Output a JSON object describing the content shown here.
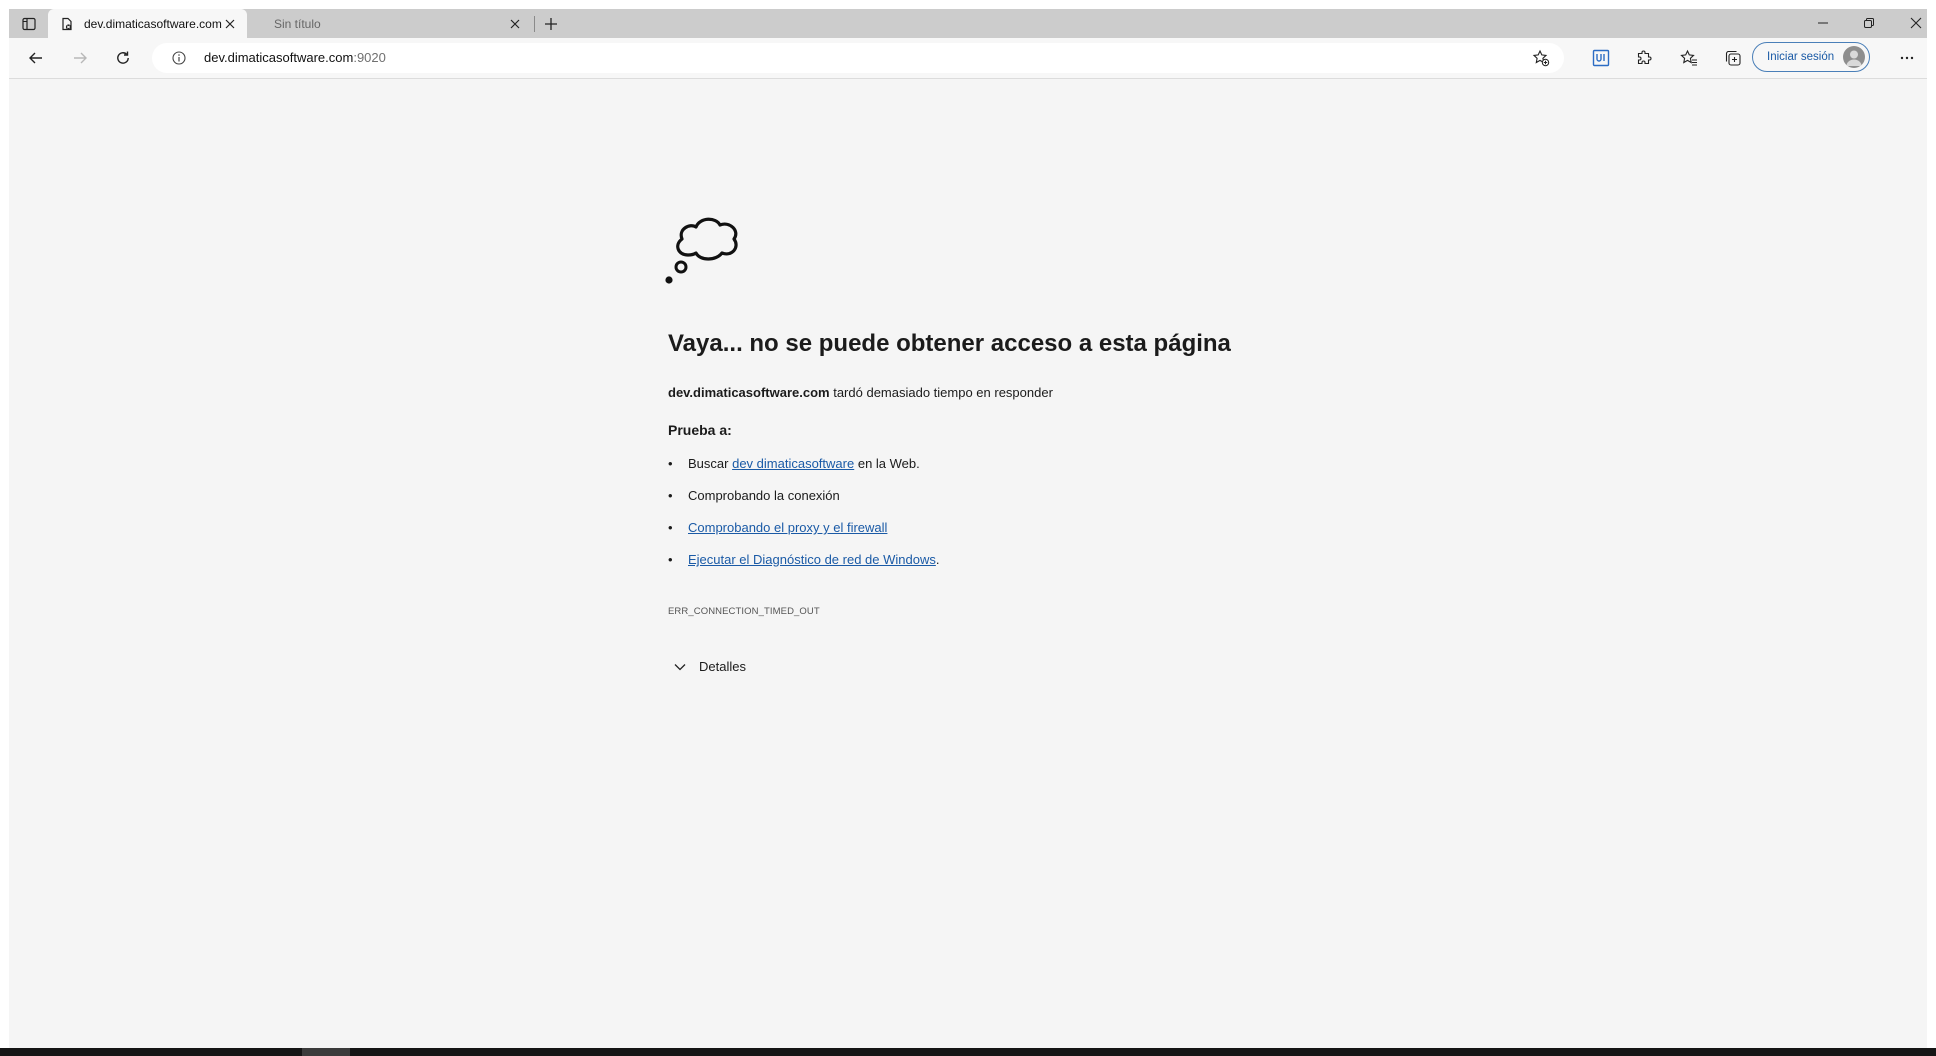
{
  "browser": {
    "tabs": [
      {
        "title": "dev.dimaticasoftware.com",
        "active": true
      },
      {
        "title": "Sin título",
        "active": false
      }
    ],
    "address": {
      "host": "dev.dimaticasoftware.com",
      "port": ":9020"
    },
    "sign_in_label": "Iniciar sesión",
    "icons": {
      "tab_actions": "tab-actions-icon",
      "new_tab": "plus-icon",
      "minimize": "minimize-icon",
      "restore": "restore-icon",
      "close": "close-icon",
      "back": "back-arrow-icon",
      "forward": "forward-arrow-icon",
      "refresh": "refresh-icon",
      "site_info": "info-icon",
      "add_favorite": "add-favorite-icon",
      "extension_ui": "ui-extension-icon",
      "extensions": "puzzle-icon",
      "favorites": "favorites-icon",
      "collections": "collections-icon",
      "more": "more-dots-icon"
    }
  },
  "error_page": {
    "icon": "thought-cloud-icon",
    "title": "Vaya... no se puede obtener acceso a esta página",
    "host": "dev.dimaticasoftware.com",
    "message": "tardó demasiado tiempo en responder",
    "try_label": "Prueba a:",
    "suggestions": {
      "search_prefix": "Buscar",
      "search_link": "dev dimaticasoftware",
      "search_suffix": "en la Web.",
      "check_connection": "Comprobando la conexión",
      "check_proxy": "Comprobando el proxy y el firewall",
      "run_diagnostics": "Ejecutar el Diagnóstico de red de Windows",
      "run_diagnostics_suffix": "."
    },
    "error_code": "ERR_CONNECTION_TIMED_OUT",
    "details_label": "Detalles"
  },
  "colors": {
    "link": "#1a5aa6",
    "page_bg": "#f5f5f5",
    "tabbar_bg": "#cccccc"
  }
}
